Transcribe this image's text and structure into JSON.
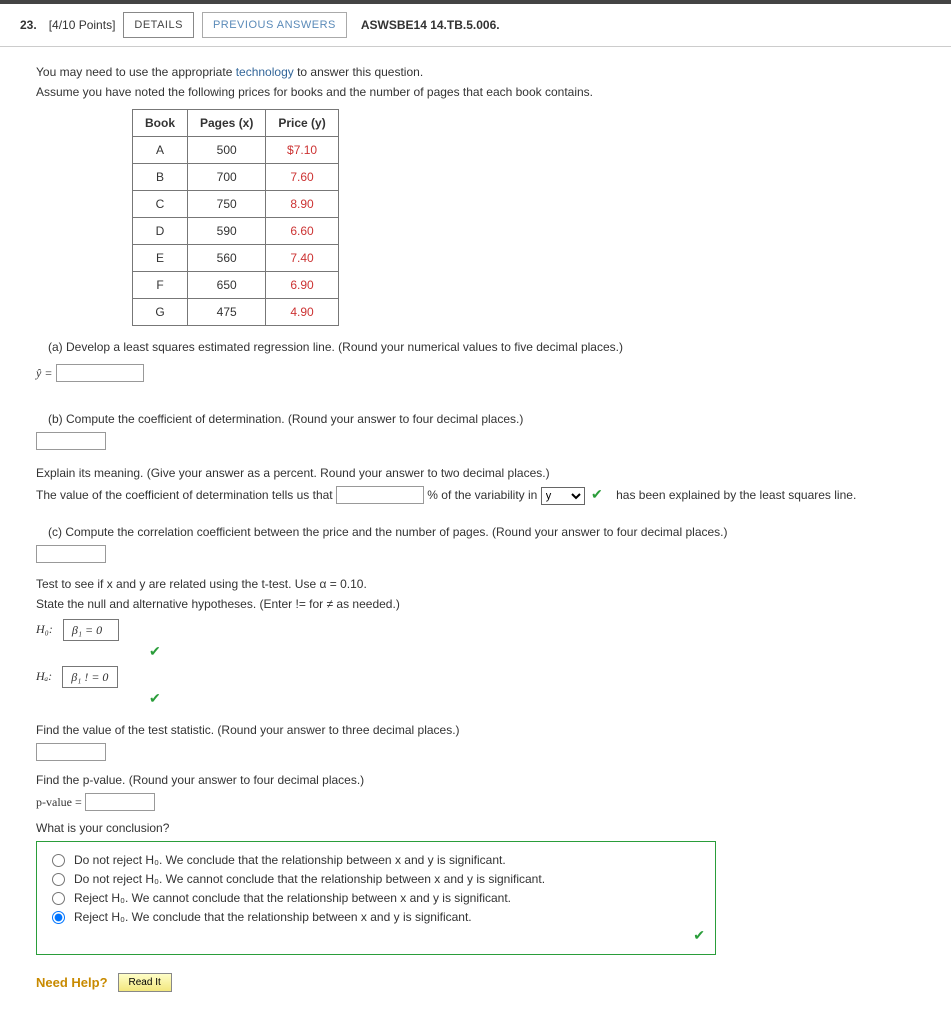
{
  "header": {
    "number": "23.",
    "points": "[4/10 Points]",
    "details_btn": "DETAILS",
    "prev_btn": "PREVIOUS ANSWERS",
    "qid": "ASWSBE14 14.TB.5.006."
  },
  "intro": {
    "line1_pre": "You may need to use the appropriate ",
    "tech": "technology",
    "line1_post": " to answer this question.",
    "line2": "Assume you have noted the following prices for books and the number of pages that each book contains."
  },
  "table": {
    "h1": "Book",
    "h2": "Pages (x)",
    "h3": "Price (y)",
    "rows": [
      {
        "b": "A",
        "p": "500",
        "pr": "$7.10"
      },
      {
        "b": "B",
        "p": "700",
        "pr": "7.60"
      },
      {
        "b": "C",
        "p": "750",
        "pr": "8.90"
      },
      {
        "b": "D",
        "p": "590",
        "pr": "6.60"
      },
      {
        "b": "E",
        "p": "560",
        "pr": "7.40"
      },
      {
        "b": "F",
        "p": "650",
        "pr": "6.90"
      },
      {
        "b": "G",
        "p": "475",
        "pr": "4.90"
      }
    ]
  },
  "a": {
    "label": "(a)",
    "text": "Develop a least squares estimated regression line. (Round your numerical values to five decimal places.)",
    "yhat": "ŷ ="
  },
  "b": {
    "label": "(b)",
    "text": "Compute the coefficient of determination. (Round your answer to four decimal places.)",
    "explain": "Explain its meaning. (Give your answer as a percent. Round your answer to two decimal places.)",
    "sentence_pre": "The value of the coefficient of determination tells us that ",
    "sentence_mid": " % of the variability in ",
    "select_val": "y",
    "sentence_post": " has been explained by the least squares line."
  },
  "c": {
    "label": "(c)",
    "text": "Compute the correlation coefficient between the price and the number of pages. (Round your answer to four decimal places.)",
    "test": "Test to see if x and y are related using the t-test. Use α = 0.10.",
    "hyp": "State the null and alternative hypotheses. (Enter != for ≠ as needed.)",
    "h0_label": "H₀:",
    "h0_val": "β₁ = 0",
    "ha_label": "Hₐ:",
    "ha_val": "β₁ ! = 0",
    "find_stat": "Find the value of the test statistic. (Round your answer to three decimal places.)",
    "find_p": "Find the p-value. (Round your answer to four decimal places.)",
    "pval_label": "p-value =",
    "conclusion_q": "What is your conclusion?",
    "opts": [
      "Do not reject H₀. We conclude that the relationship between x and y is significant.",
      "Do not reject H₀. We cannot conclude that the relationship between x and y is significant.",
      "Reject H₀. We cannot conclude that the relationship between x and y is significant.",
      "Reject H₀. We conclude that the relationship between x and y is significant."
    ]
  },
  "help": {
    "label": "Need Help?",
    "read": "Read It"
  }
}
